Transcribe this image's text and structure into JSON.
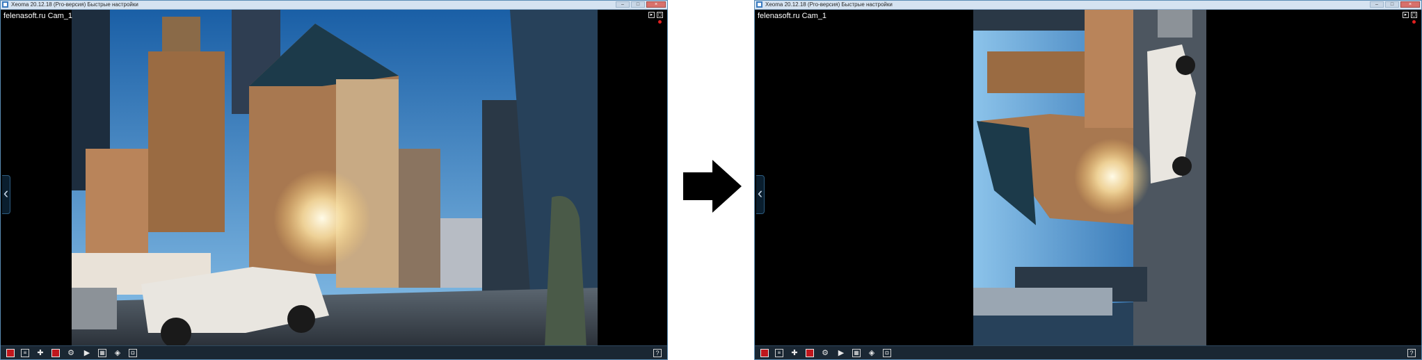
{
  "left_window": {
    "title": "Xeoma 20.12.18 (Pro-версия) Быстрые настройки",
    "camera_label": "felenasoft.ru Cam_1"
  },
  "right_window": {
    "title": "Xeoma 20.12.18 (Pro-версия) Быстрые настройки",
    "camera_label": "felenasoft.ru Cam_1"
  },
  "toolbar_icons": [
    "stop-icon",
    "list-icon",
    "plus-icon",
    "stop-icon",
    "gear-icon",
    "play-icon",
    "layout-icon",
    "mask-icon",
    "screenshot-icon"
  ],
  "help_label": "?",
  "colors": {
    "accent": "#5a8db5",
    "record_red": "#c0171d",
    "arrow": "#000000"
  }
}
